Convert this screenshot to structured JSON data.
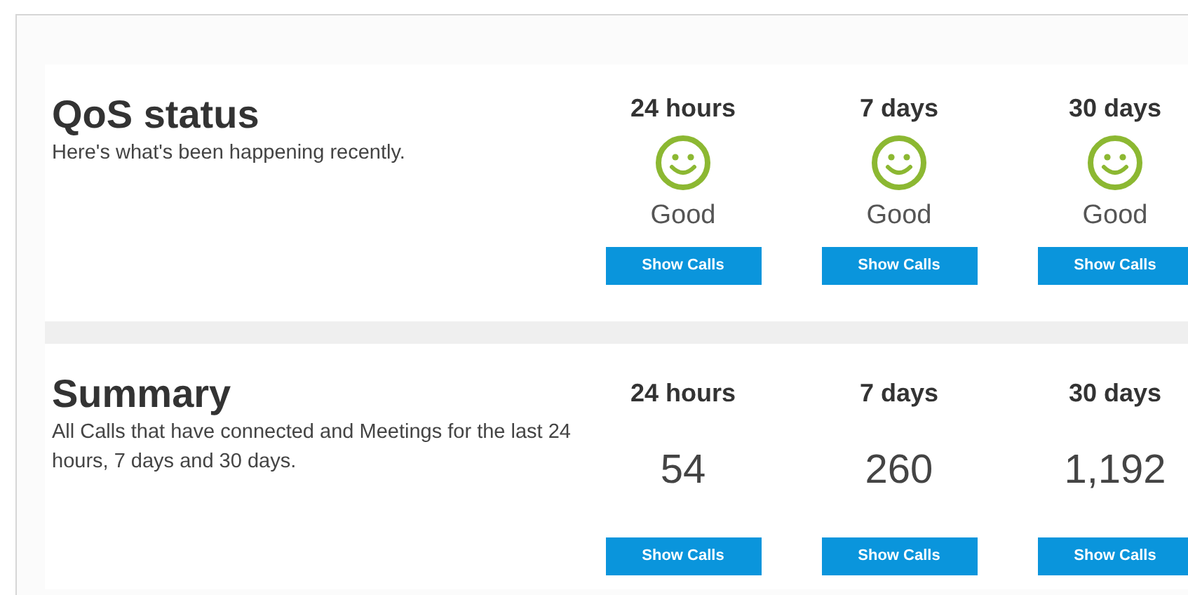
{
  "sections": [
    {
      "kind": "status",
      "title": "QoS status",
      "description": "Here's what's been happening recently.",
      "periods": [
        {
          "label": "24 hours",
          "value": "Good",
          "button": "Show Calls"
        },
        {
          "label": "7 days",
          "value": "Good",
          "button": "Show Calls"
        },
        {
          "label": "30 days",
          "value": "Good",
          "button": "Show Calls"
        }
      ]
    },
    {
      "kind": "count",
      "title": "Summary",
      "description": "All Calls that have connected and Meetings for the last 24 hours, 7 days and 30 days.",
      "periods": [
        {
          "label": "24 hours",
          "value": "54",
          "button": "Show Calls"
        },
        {
          "label": "7 days",
          "value": "260",
          "button": "Show Calls"
        },
        {
          "label": "30 days",
          "value": "1,192",
          "button": "Show Calls"
        }
      ]
    }
  ]
}
